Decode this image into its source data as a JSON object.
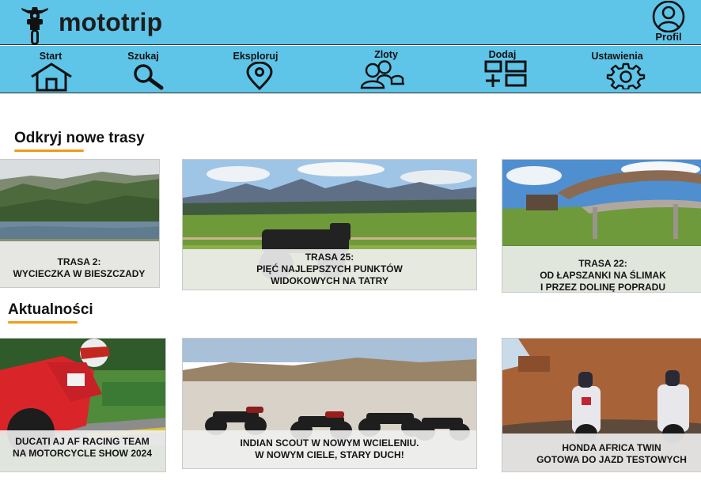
{
  "header": {
    "brand": "mototrip",
    "profile_label": "Profil"
  },
  "nav": [
    {
      "label": "Start",
      "icon": "home-icon"
    },
    {
      "label": "Szukaj",
      "icon": "search-icon"
    },
    {
      "label": "Eksploruj",
      "icon": "location-pin-icon"
    },
    {
      "label": "Zloty",
      "icon": "users-icon"
    },
    {
      "label": "Dodaj",
      "icon": "add-grid-icon"
    },
    {
      "label": "Ustawienia",
      "icon": "gear-icon"
    }
  ],
  "routes": {
    "title": "Odkryj nowe trasy",
    "cards": [
      {
        "lines": [
          "TRASA 2:",
          "WYCIECZKA W BIESZCZADY"
        ]
      },
      {
        "lines": [
          "TRASA 25:",
          "PIĘĆ NAJLEPSZYCH PUNKTÓW",
          "WIDOKOWYCH NA TATRY"
        ]
      },
      {
        "lines": [
          "TRASA 22:",
          "OD ŁAPSZANKI NA ŚLIMAK",
          "I PRZEZ DOLINĘ POPRADU"
        ]
      }
    ]
  },
  "news": {
    "title": "Aktualności",
    "cards": [
      {
        "lines": [
          "DUCATI AJ AF RACING TEAM",
          "NA MOTORCYCLE SHOW 2024"
        ]
      },
      {
        "lines": [
          "INDIAN SCOUT W NOWYM WCIELENIU.",
          "W NOWYM CIELE, STARY DUCH!"
        ]
      },
      {
        "lines": [
          "HONDA AFRICA TWIN",
          "GOTOWA DO JAZD TESTOWYCH"
        ]
      }
    ]
  }
}
